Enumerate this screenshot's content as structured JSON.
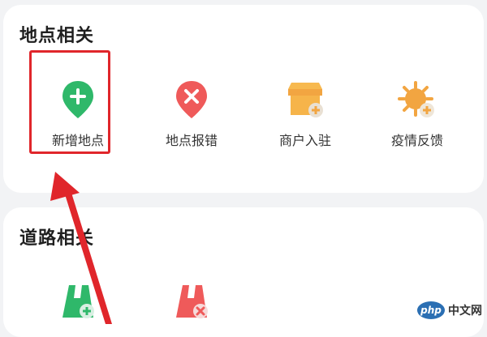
{
  "place_section": {
    "title": "地点相关",
    "items": [
      {
        "label": "新增地点",
        "icon": "location-add-icon",
        "color": "#2fb86a"
      },
      {
        "label": "地点报错",
        "icon": "location-error-icon",
        "color": "#ef5a5a"
      },
      {
        "label": "商户入驻",
        "icon": "merchant-enter-icon",
        "color": "#f2a541"
      },
      {
        "label": "疫情反馈",
        "icon": "epidemic-feedback-icon",
        "color": "#f2a541"
      }
    ]
  },
  "road_section": {
    "title": "道路相关",
    "items": [
      {
        "label": "",
        "icon": "road-add-icon",
        "color": "#2fb86a"
      },
      {
        "label": "",
        "icon": "road-error-icon",
        "color": "#ef5a5a"
      }
    ]
  },
  "annotation": {
    "highlight_color": "#e0262b"
  },
  "watermark": {
    "badge": "php",
    "text": "中文网"
  }
}
